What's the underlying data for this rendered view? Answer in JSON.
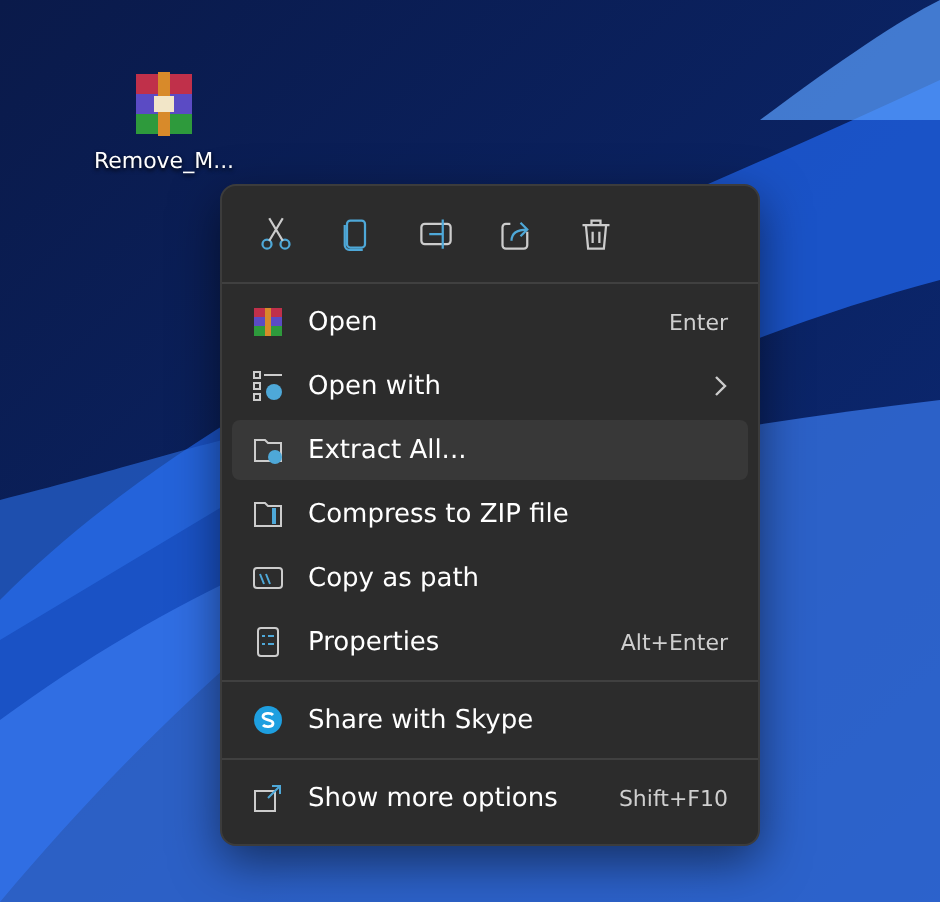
{
  "desktop_icon": {
    "label": "Remove_M..."
  },
  "context_menu": {
    "sections": [
      {
        "items": [
          {
            "label": "Open",
            "shortcut": "Enter",
            "submenu": false,
            "selected": false
          },
          {
            "label": "Open with",
            "submenu": true,
            "selected": false
          },
          {
            "label": "Extract All...",
            "submenu": false,
            "selected": true
          },
          {
            "label": "Compress to ZIP file",
            "submenu": false,
            "selected": false
          },
          {
            "label": "Copy as path",
            "submenu": false,
            "selected": false
          },
          {
            "label": "Properties",
            "shortcut": "Alt+Enter",
            "submenu": false,
            "selected": false
          }
        ]
      },
      {
        "items": [
          {
            "label": "Share with Skype",
            "submenu": false,
            "selected": false
          }
        ]
      },
      {
        "items": [
          {
            "label": "Show more options",
            "shortcut": "Shift+F10",
            "submenu": false,
            "selected": false
          }
        ]
      }
    ]
  }
}
